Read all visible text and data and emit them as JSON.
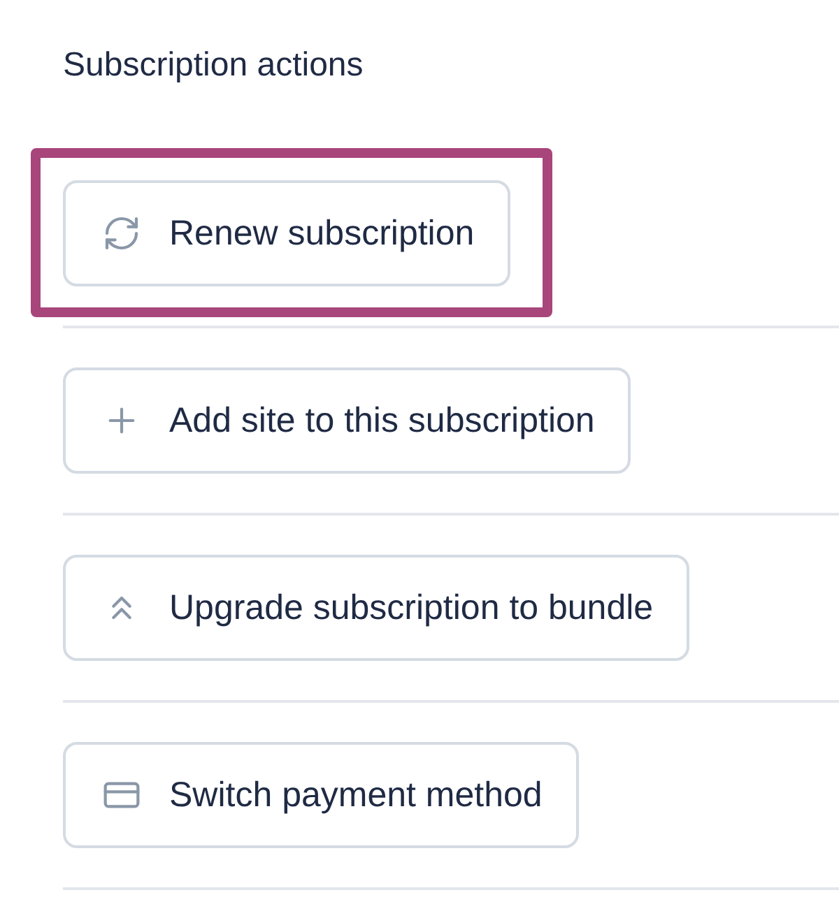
{
  "title": "Subscription actions",
  "actions": [
    {
      "label": "Renew subscription",
      "kind": "renew",
      "highlighted": true
    },
    {
      "label": "Add site to this subscription",
      "kind": "add",
      "highlighted": false
    },
    {
      "label": "Upgrade subscription to bundle",
      "kind": "upgrade",
      "highlighted": false
    },
    {
      "label": "Switch payment method",
      "kind": "payment",
      "highlighted": false
    }
  ]
}
